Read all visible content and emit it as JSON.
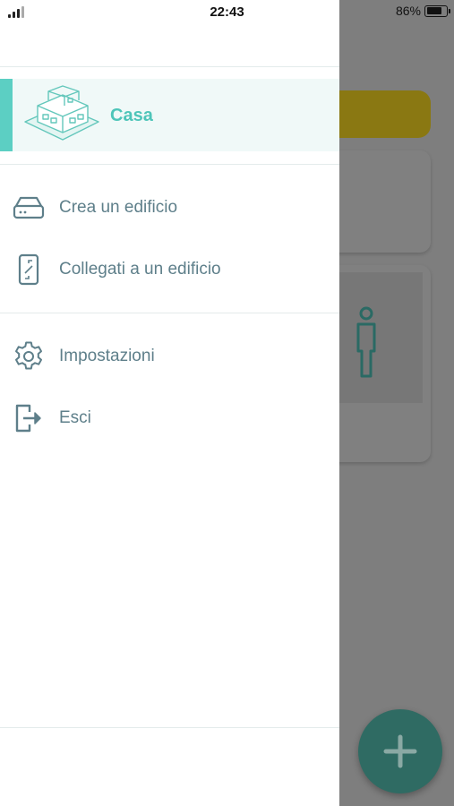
{
  "status_bar": {
    "time": "22:43",
    "battery_percent": "86%",
    "battery_level": 0.86,
    "signal_bars": 2
  },
  "drawer": {
    "building": {
      "name": "Casa",
      "icon": "building-illustration-icon"
    },
    "menu": [
      {
        "label": "Crea un edificio",
        "icon": "router-icon"
      },
      {
        "label": "Collegati a un edificio",
        "icon": "phone-icon"
      },
      {
        "label": "Impostazioni",
        "icon": "gear-icon"
      },
      {
        "label": "Esci",
        "icon": "logout-icon"
      }
    ]
  },
  "background": {
    "fab_icon": "plus-icon"
  },
  "colors": {
    "accent": "#5ccfc3",
    "accent_text": "#4ec5b9",
    "menu_text": "#5e7f8a",
    "selected_bg": "#f0f9f8",
    "overlay": "#808080"
  }
}
